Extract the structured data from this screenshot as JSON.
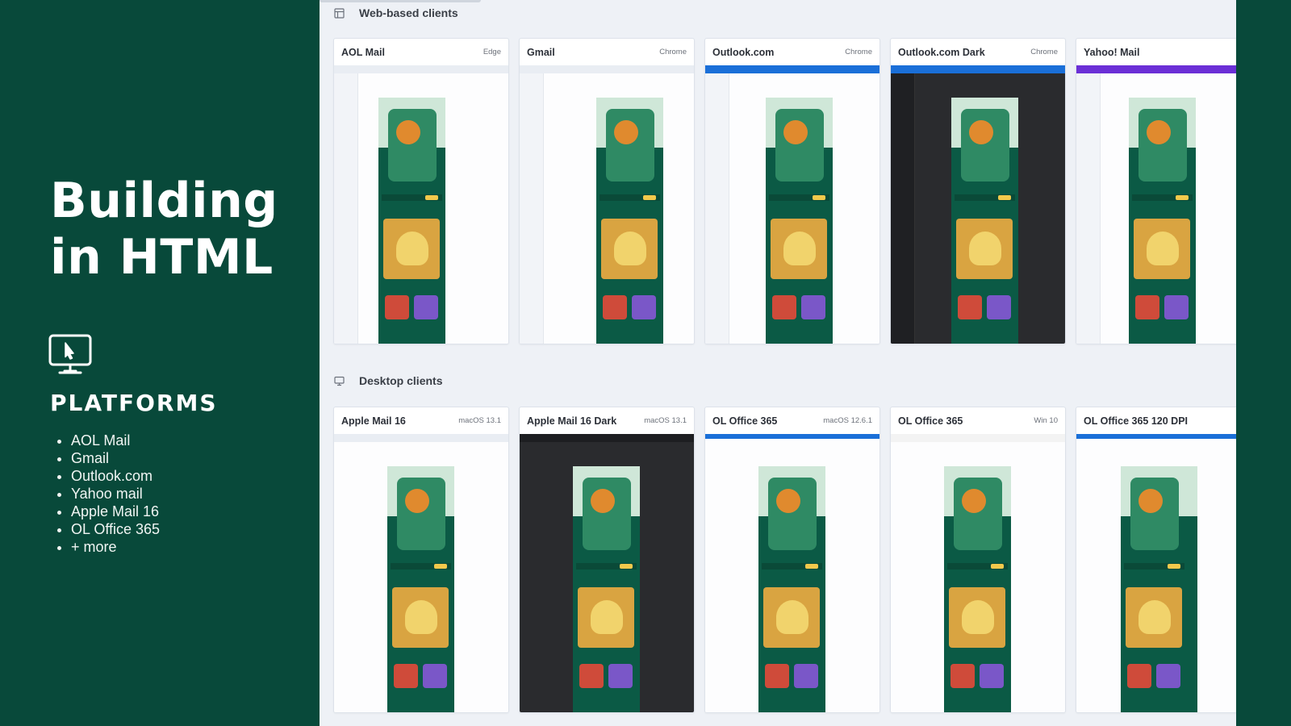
{
  "left_panel": {
    "title_line1": "Building",
    "title_line2": "in HTML",
    "icon": "monitor-cursor-icon",
    "heading": "PLATFORMS",
    "items": [
      "AOL Mail",
      "Gmail",
      "Outlook.com",
      "Yahoo mail",
      "Apple Mail 16",
      "OL Office 365",
      "+ more"
    ]
  },
  "sections": {
    "web": {
      "label": "Web-based clients",
      "icon": "browser-window-icon",
      "cards": [
        {
          "name": "AOL Mail",
          "meta": "Edge"
        },
        {
          "name": "Gmail",
          "meta": "Chrome"
        },
        {
          "name": "Outlook.com",
          "meta": "Chrome"
        },
        {
          "name": "Outlook.com Dark",
          "meta": "Chrome"
        },
        {
          "name": "Yahoo! Mail",
          "meta": ""
        }
      ]
    },
    "desktop": {
      "label": "Desktop clients",
      "icon": "desktop-monitor-icon",
      "cards": [
        {
          "name": "Apple Mail 16",
          "meta": "macOS 13.1"
        },
        {
          "name": "Apple Mail 16 Dark",
          "meta": "macOS 13.1"
        },
        {
          "name": "OL Office 365",
          "meta": "macOS 12.6.1"
        },
        {
          "name": "OL Office 365",
          "meta": "Win 10"
        },
        {
          "name": "OL Office 365 120 DPI",
          "meta": ""
        }
      ]
    }
  },
  "colors": {
    "brand_green": "#08493a",
    "canvas_bg": "#eef1f6",
    "email_green": "#0b5a45"
  }
}
